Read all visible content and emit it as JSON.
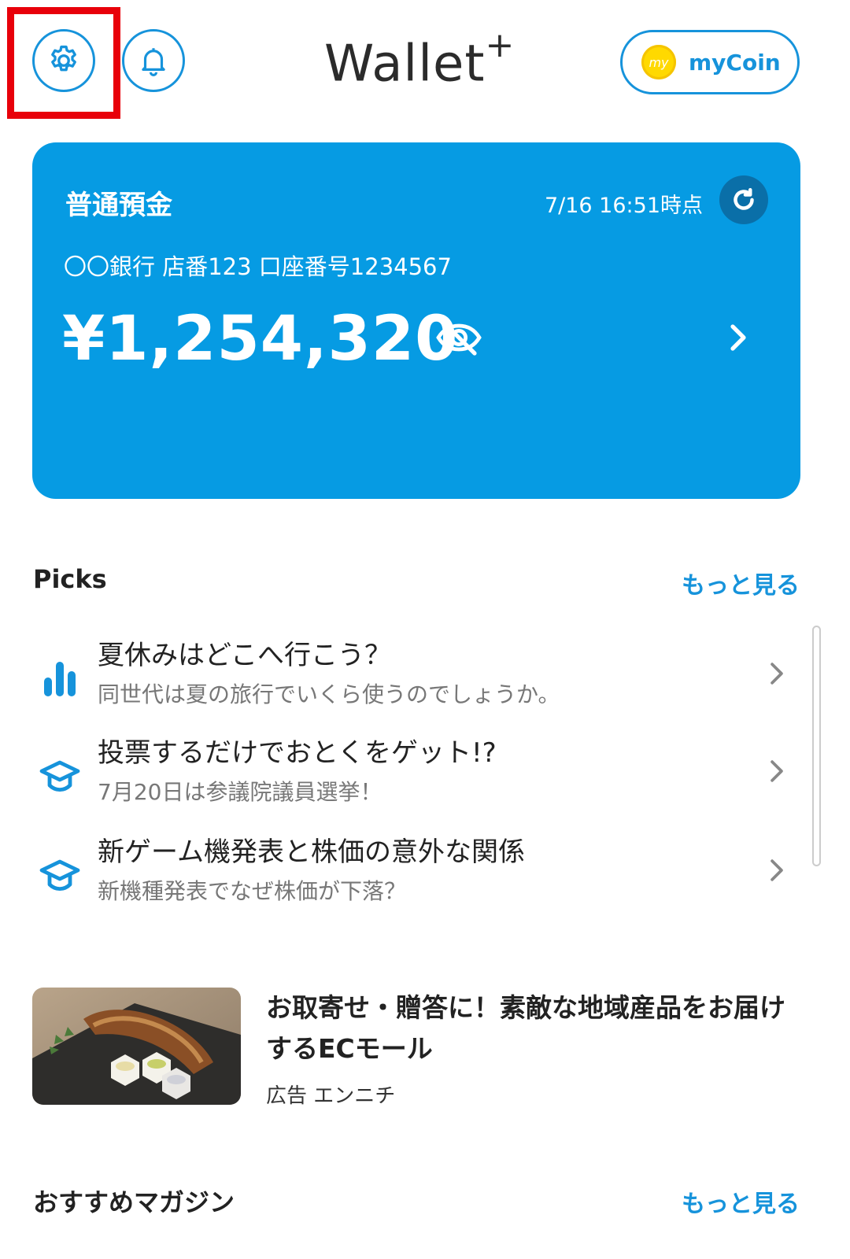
{
  "header": {
    "logo": "Wallet",
    "logo_plus": "+",
    "coin_badge": "my",
    "coin_label": "myCoin"
  },
  "account_card": {
    "type": "普通預金",
    "updated": "7/16 16:51時点",
    "account_info": "〇〇銀行 店番123 口座番号1234567",
    "balance": "¥1,254,320"
  },
  "picks": {
    "title": "Picks",
    "more": "もっと見る",
    "items": [
      {
        "title": "夏休みはどこへ行こう？",
        "subtitle": "同世代は夏の旅行でいくら使うのでしょうか。",
        "icon": "bar-chart-icon"
      },
      {
        "title": "投票するだけでおとくをゲット!?",
        "subtitle": "7月20日は参議院議員選挙！",
        "icon": "graduation-cap-icon"
      },
      {
        "title": "新ゲーム機発表と株価の意外な関係",
        "subtitle": "新機種発表でなぜ株価が下落？",
        "icon": "graduation-cap-icon"
      }
    ]
  },
  "ad": {
    "title": "お取寄せ・贈答に！素敵な地域産品をお届けするECモール",
    "meta": "広告 エンニチ"
  },
  "magazine": {
    "title": "おすすめマガジン",
    "more": "もっと見る"
  },
  "colors": {
    "accent": "#1693db",
    "card": "#069be3",
    "highlight": "#e8000a"
  }
}
